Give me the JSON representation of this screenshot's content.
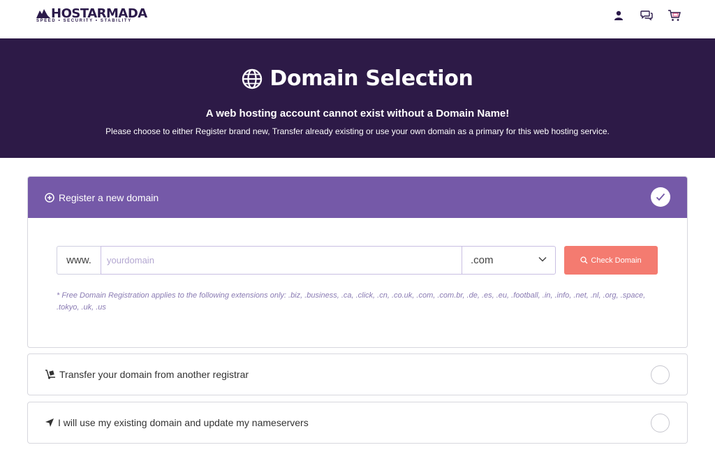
{
  "brand": {
    "name": "HOSTARMADA",
    "tagline": "SPEED • SECURITY • STABILITY",
    "primary_color": "#2d1a47",
    "accent_color": "#7559a8",
    "button_color": "#f47b70"
  },
  "header": {
    "icons": [
      "user-icon",
      "chat-icon",
      "cart-icon"
    ]
  },
  "hero": {
    "title": "Domain Selection",
    "subtitle": "A web hosting account cannot exist without a Domain Name!",
    "description": "Please choose to either Register brand new, Transfer already existing or use your own domain as a primary for this web hosting service."
  },
  "options": {
    "register": {
      "label": "Register a new domain",
      "selected": true,
      "prefix": "www.",
      "input_value": "",
      "input_placeholder": "yourdomain",
      "tld_selected": ".com",
      "check_button_label": "Check Domain",
      "note": "* Free Domain Registration applies to the following extensions only: .biz, .business, .ca, .click, .cn, .co.uk, .com, .com.br, .de, .es, .eu, .football, .in, .info, .net, .nl, .org, .space, .tokyo, .uk, .us"
    },
    "transfer": {
      "label": "Transfer your domain from another registrar",
      "selected": false
    },
    "existing": {
      "label": "I will use my existing domain and update my nameservers",
      "selected": false
    }
  }
}
